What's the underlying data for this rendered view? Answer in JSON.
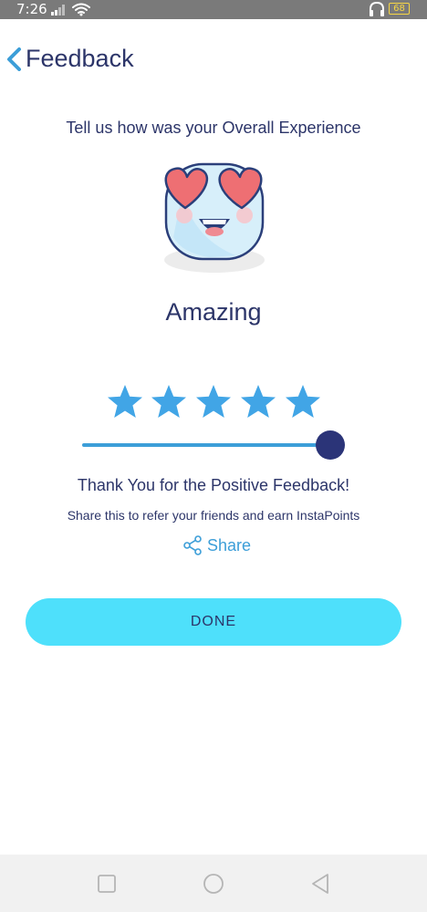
{
  "status_bar": {
    "time": "7:26",
    "battery": "68",
    "icons": [
      "signal-icon",
      "wifi-icon",
      "headset-icon",
      "battery-icon"
    ]
  },
  "header": {
    "title": "Feedback",
    "back_icon": "chevron-left-icon"
  },
  "feedback": {
    "prompt": "Tell us how was your Overall Experience",
    "emoji": "heart-eyes-emoji",
    "rating_label": "Amazing",
    "rating": 5,
    "max_rating": 5,
    "slider_level": 1.0,
    "thanks_text": "Thank You for the Positive Feedback!",
    "share_prompt": "Share this to refer your friends and earn InstaPoints",
    "share_label": "Share"
  },
  "actions": {
    "done_label": "DONE"
  },
  "nav_bar": {
    "icons": [
      "square-icon",
      "circle-icon",
      "triangle-back-icon"
    ]
  },
  "colors": {
    "primary_text": "#2c3569",
    "accent_blue": "#3c9ed8",
    "star": "#41a5e6",
    "button": "#4ee0fb",
    "slider_thumb": "#2b3478",
    "status_bar": "#7a7a7a"
  }
}
